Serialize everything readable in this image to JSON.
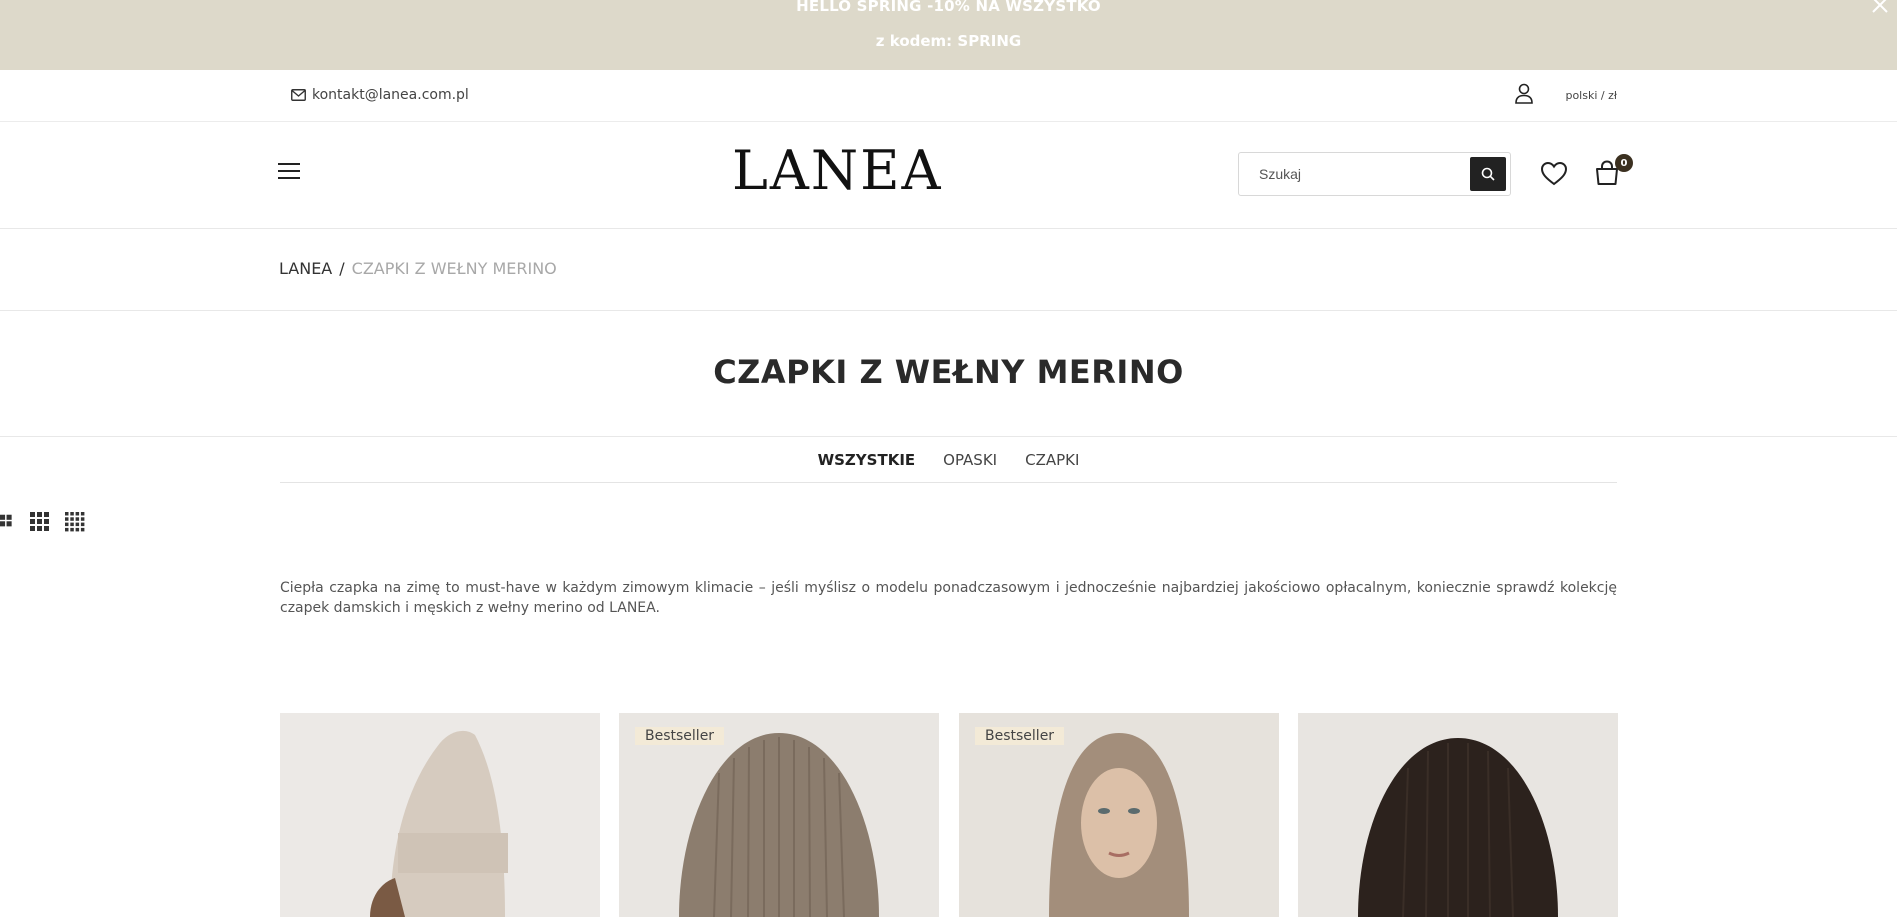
{
  "promo": {
    "line1": "HELLO SPRING -10% NA WSZYSTKO",
    "line2": "z kodem: SPRING"
  },
  "topbar": {
    "email": "kontakt@lanea.com.pl",
    "language_currency": "polski / zł"
  },
  "header": {
    "logo": "LANEA",
    "search_placeholder": "Szukaj",
    "cart_count": "0"
  },
  "breadcrumb": {
    "home": "LANEA",
    "separator": "/",
    "current": "CZAPKI Z WEŁNY MERINO"
  },
  "page_title": "CZAPKI Z WEŁNY MERINO",
  "tabs": [
    {
      "label": "WSZYSTKIE",
      "active": true
    },
    {
      "label": "OPASKI",
      "active": false
    },
    {
      "label": "CZAPKI",
      "active": false
    }
  ],
  "description": "Ciepła czapka na zimę to must-have w każdym zimowym klimacie – jeśli myślisz o modelu ponadczasowym i jednocześnie najbardziej jakościowo opłacalnym, koniecznie sprawdź kolekcję czapek damskich i męskich z wełny merino od LANEA.",
  "products": [
    {
      "badge": "",
      "color": "#d8cfc4"
    },
    {
      "badge": "Bestseller",
      "color": "#8d7e6f"
    },
    {
      "badge": "Bestseller",
      "color": "#a08c7a"
    },
    {
      "badge": "",
      "color": "#2e241f"
    }
  ]
}
